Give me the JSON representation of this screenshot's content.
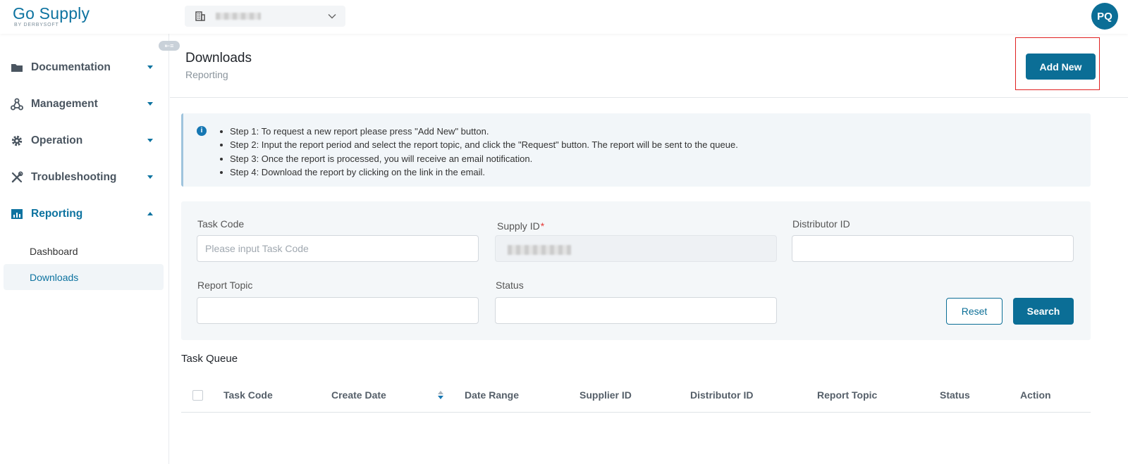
{
  "app": {
    "logo_main": "Go Supply",
    "logo_sub": "BY DERBYSOFT",
    "user_initials": "PQ"
  },
  "supplier_select": {
    "icon": "building-icon"
  },
  "sidebar": {
    "items": [
      {
        "label": "Documentation",
        "icon": "folder-icon"
      },
      {
        "label": "Management",
        "icon": "hierarchy-icon"
      },
      {
        "label": "Operation",
        "icon": "gear-icon"
      },
      {
        "label": "Troubleshooting",
        "icon": "tools-icon"
      },
      {
        "label": "Reporting",
        "icon": "report-chart-icon"
      }
    ],
    "sub_items": [
      {
        "label": "Dashboard"
      },
      {
        "label": "Downloads"
      }
    ]
  },
  "page": {
    "title": "Downloads",
    "subtitle": "Reporting",
    "add_new_label": "Add New"
  },
  "info": {
    "steps": [
      "Step 1: To request a new report please press \"Add New\" button.",
      "Step 2: Input the report period and select the report topic, and click the \"Request\" button. The report will be sent to the queue.",
      "Step 3: Once the report is processed, you will receive an email notification.",
      "Step 4: Download the report by clicking on the link in the email."
    ]
  },
  "filters": {
    "task_code_label": "Task Code",
    "task_code_placeholder": "Please input Task Code",
    "supply_id_label": "Supply ID",
    "required_mark": "*",
    "distributor_id_label": "Distributor ID",
    "report_topic_label": "Report Topic",
    "status_label": "Status",
    "reset_label": "Reset",
    "search_label": "Search"
  },
  "task_queue": {
    "title": "Task Queue",
    "columns": [
      "Task Code",
      "Create Date",
      "Date Range",
      "Supplier ID",
      "Distributor ID",
      "Report Topic",
      "Status",
      "Action"
    ]
  },
  "colors": {
    "primary": "#0b6e96",
    "highlight_outline": "#e02020",
    "required": "#e53935"
  }
}
